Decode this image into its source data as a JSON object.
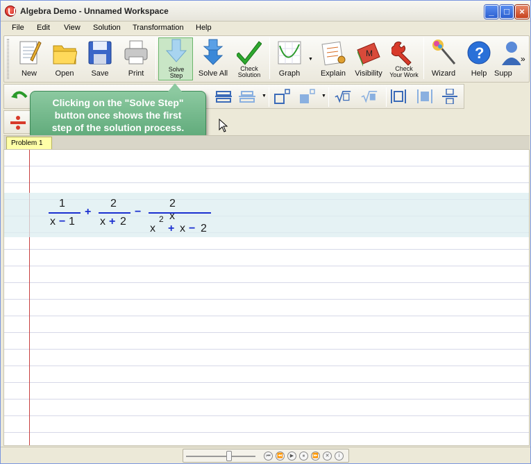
{
  "window": {
    "title": "Algebra Demo - Unnamed Workspace"
  },
  "menu": [
    "File",
    "Edit",
    "View",
    "Solution",
    "Transformation",
    "Help"
  ],
  "toolbar": {
    "new": "New",
    "open": "Open",
    "save": "Save",
    "print": "Print",
    "solve_step": [
      "Solve",
      "Step"
    ],
    "solve_all": "Solve All",
    "check_solution": [
      "Check",
      "Solution"
    ],
    "graph": "Graph",
    "explain": "Explain",
    "visibility": "Visibility",
    "check_your_work": [
      "Check",
      "Your Work"
    ],
    "wizard": "Wizard",
    "help": "Help",
    "support": "Supp",
    "overflow": "»"
  },
  "tooltip": {
    "lines": [
      "Clicking on the \"Solve Step\"",
      "button once shows the first",
      "step of the solution process."
    ]
  },
  "tabs": [
    "Problem 1"
  ],
  "expression": {
    "term1_num": "1",
    "term1_den_x": "x",
    "term1_den_op": "−",
    "term1_den_c": "1",
    "op1": "+",
    "term2_num": "2",
    "term2_den_x": "x",
    "term2_den_op": "+",
    "term2_den_c": "2",
    "op2": "−",
    "term3_num": "2 x",
    "term3_den_x": "x",
    "term3_den_exp": "2",
    "term3_den_op1": "+",
    "term3_den_x2": "x",
    "term3_den_op2": "−",
    "term3_den_c": "2"
  },
  "colors": {
    "accent": "#1a2fd0",
    "tooltip": "#6fb486",
    "margin": "#c84040"
  }
}
